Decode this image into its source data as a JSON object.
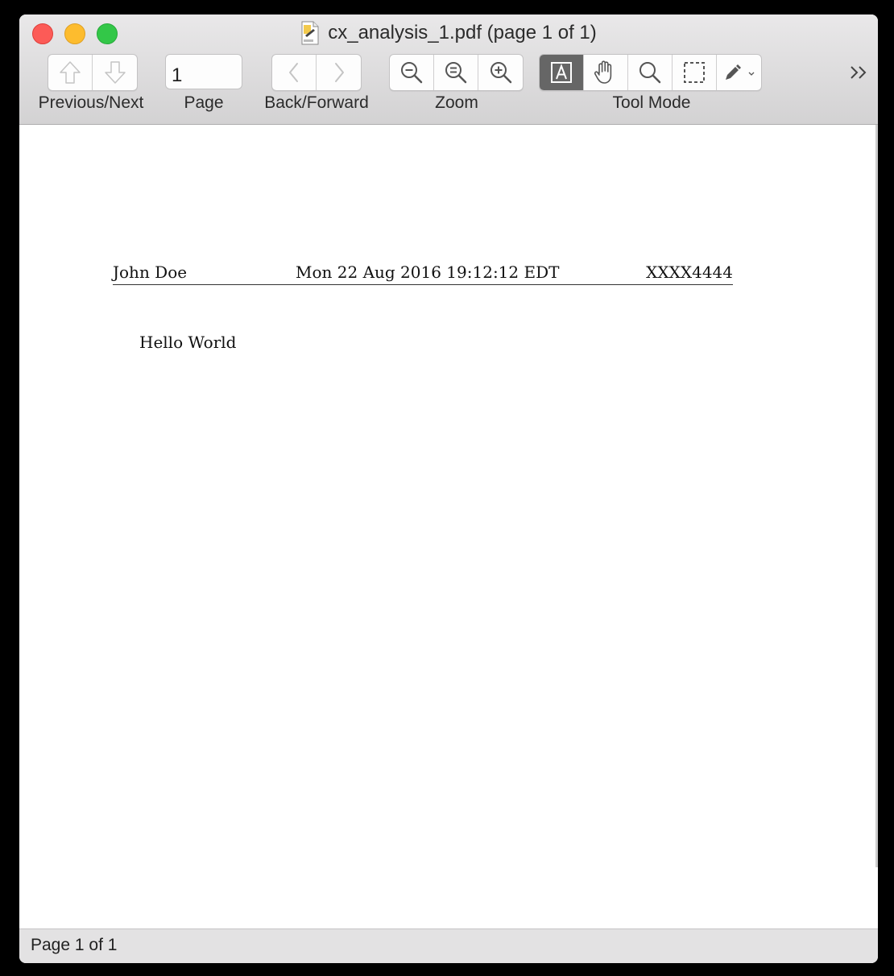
{
  "window": {
    "title": "cx_analysis_1.pdf (page 1 of 1)"
  },
  "toolbar": {
    "prev_next_label": "Previous/Next",
    "page_label": "Page",
    "page_value": "1",
    "back_forward_label": "Back/Forward",
    "zoom_label": "Zoom",
    "tool_mode_label": "Tool Mode",
    "buttons": [
      {
        "name": "previous-page",
        "icon": "arrow-up-icon",
        "enabled": false
      },
      {
        "name": "next-page",
        "icon": "arrow-down-icon",
        "enabled": false
      },
      {
        "name": "back",
        "icon": "chevron-left-icon",
        "enabled": false
      },
      {
        "name": "forward",
        "icon": "chevron-right-icon",
        "enabled": false
      },
      {
        "name": "zoom-out",
        "icon": "zoom-out-icon"
      },
      {
        "name": "actual-size",
        "icon": "zoom-actual-icon"
      },
      {
        "name": "zoom-in",
        "icon": "zoom-in-icon"
      },
      {
        "name": "text-tool",
        "icon": "text-select-icon",
        "selected": true
      },
      {
        "name": "move-tool",
        "icon": "hand-icon"
      },
      {
        "name": "magnify-tool",
        "icon": "magnifier-icon"
      },
      {
        "name": "select-tool",
        "icon": "marquee-icon"
      },
      {
        "name": "annotate-tool",
        "icon": "pen-icon"
      }
    ]
  },
  "document": {
    "header": {
      "name": "John Doe",
      "date": "Mon 22 Aug 2016 19:12:12 EDT",
      "id": "XXXX4444"
    },
    "body": "Hello World"
  },
  "status": {
    "text": "Page 1 of 1"
  },
  "colors": {
    "close": "#fc5b57",
    "minimize": "#fdbc2e",
    "maximize": "#33c748",
    "active_tool": "#666666"
  }
}
